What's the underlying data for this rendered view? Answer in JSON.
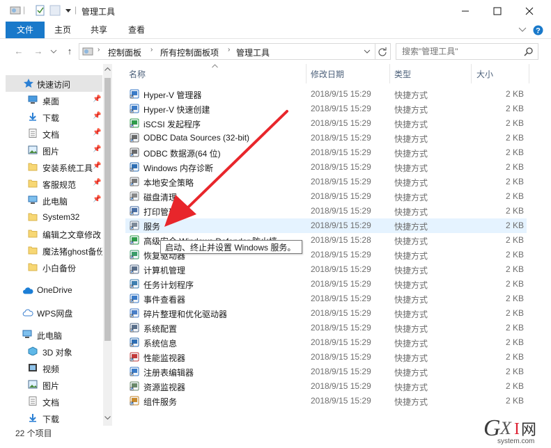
{
  "window": {
    "title": "管理工具",
    "min_label": "─",
    "max_label": "☐",
    "close_label": "✕"
  },
  "ribbon": {
    "tabs": [
      {
        "label": "文件"
      },
      {
        "label": "主页"
      },
      {
        "label": "共享"
      },
      {
        "label": "查看"
      }
    ]
  },
  "address": {
    "crumbs": [
      "控制面板",
      "所有控制面板项",
      "管理工具"
    ]
  },
  "search": {
    "placeholder": "搜索\"管理工具\""
  },
  "sidebar": {
    "quick_access": "快速访问",
    "items": [
      {
        "label": "桌面",
        "icon": "desktop-icon",
        "pinned": true
      },
      {
        "label": "下载",
        "icon": "download-icon",
        "pinned": true
      },
      {
        "label": "文档",
        "icon": "document-icon",
        "pinned": true
      },
      {
        "label": "图片",
        "icon": "picture-icon",
        "pinned": true
      },
      {
        "label": "安装系统工具",
        "icon": "folder-icon",
        "pinned": true
      },
      {
        "label": "客服规范",
        "icon": "folder-icon",
        "pinned": true
      },
      {
        "label": "此电脑",
        "icon": "pc-icon",
        "pinned": true
      },
      {
        "label": "System32",
        "icon": "folder-icon",
        "pinned": false
      },
      {
        "label": "编辑之文章修改",
        "icon": "folder-icon",
        "pinned": false
      },
      {
        "label": "魔法猪ghost备份",
        "icon": "folder-icon",
        "pinned": false
      },
      {
        "label": "小白备份",
        "icon": "folder-icon",
        "pinned": false
      }
    ],
    "onedrive": "OneDrive",
    "wps": "WPS网盘",
    "thispc": "此电脑",
    "pc_items": [
      {
        "label": "3D 对象",
        "icon": "3d-objects-icon"
      },
      {
        "label": "视频",
        "icon": "video-icon"
      },
      {
        "label": "图片",
        "icon": "picture-icon"
      },
      {
        "label": "文档",
        "icon": "document-icon"
      },
      {
        "label": "下载",
        "icon": "download-icon"
      }
    ]
  },
  "columns": {
    "name": "名称",
    "date": "修改日期",
    "type": "类型",
    "size": "大小"
  },
  "files": [
    {
      "name": "Hyper-V 管理器",
      "date": "2018/9/15 15:29",
      "type": "快捷方式",
      "size": "2 KB"
    },
    {
      "name": "Hyper-V 快速创建",
      "date": "2018/9/15 15:29",
      "type": "快捷方式",
      "size": "2 KB"
    },
    {
      "name": "iSCSI 发起程序",
      "date": "2018/9/15 15:29",
      "type": "快捷方式",
      "size": "2 KB"
    },
    {
      "name": "ODBC Data Sources (32-bit)",
      "date": "2018/9/15 15:29",
      "type": "快捷方式",
      "size": "2 KB"
    },
    {
      "name": "ODBC 数据源(64 位)",
      "date": "2018/9/15 15:29",
      "type": "快捷方式",
      "size": "2 KB"
    },
    {
      "name": "Windows 内存诊断",
      "date": "2018/9/15 15:29",
      "type": "快捷方式",
      "size": "2 KB"
    },
    {
      "name": "本地安全策略",
      "date": "2018/9/15 15:29",
      "type": "快捷方式",
      "size": "2 KB"
    },
    {
      "name": "磁盘清理",
      "date": "2018/9/15 15:29",
      "type": "快捷方式",
      "size": "2 KB"
    },
    {
      "name": "打印管理",
      "date": "2018/9/15 15:29",
      "type": "快捷方式",
      "size": "2 KB"
    },
    {
      "name": "服务",
      "date": "2018/9/15 15:29",
      "type": "快捷方式",
      "size": "2 KB"
    },
    {
      "name": "高级安全 Windows Defender 防火墙",
      "date": "2018/9/15 15:28",
      "type": "快捷方式",
      "size": "2 KB"
    },
    {
      "name": "恢复驱动器",
      "date": "2018/9/15 15:29",
      "type": "快捷方式",
      "size": "2 KB"
    },
    {
      "name": "计算机管理",
      "date": "2018/9/15 15:29",
      "type": "快捷方式",
      "size": "2 KB"
    },
    {
      "name": "任务计划程序",
      "date": "2018/9/15 15:29",
      "type": "快捷方式",
      "size": "2 KB"
    },
    {
      "name": "事件查看器",
      "date": "2018/9/15 15:29",
      "type": "快捷方式",
      "size": "2 KB"
    },
    {
      "name": "碎片整理和优化驱动器",
      "date": "2018/9/15 15:29",
      "type": "快捷方式",
      "size": "2 KB"
    },
    {
      "name": "系统配置",
      "date": "2018/9/15 15:29",
      "type": "快捷方式",
      "size": "2 KB"
    },
    {
      "name": "系统信息",
      "date": "2018/9/15 15:29",
      "type": "快捷方式",
      "size": "2 KB"
    },
    {
      "name": "性能监视器",
      "date": "2018/9/15 15:29",
      "type": "快捷方式",
      "size": "2 KB"
    },
    {
      "name": "注册表编辑器",
      "date": "2018/9/15 15:29",
      "type": "快捷方式",
      "size": "2 KB"
    },
    {
      "name": "资源监视器",
      "date": "2018/9/15 15:29",
      "type": "快捷方式",
      "size": "2 KB"
    },
    {
      "name": "组件服务",
      "date": "2018/9/15 15:29",
      "type": "快捷方式",
      "size": "2 KB"
    }
  ],
  "tooltip": "启动、终止并设置 Windows 服务。",
  "status": {
    "count": "22 个项目"
  },
  "watermark": {
    "brand": "GXI网",
    "site": "system.com"
  },
  "colors": {
    "accent": "#1979ca",
    "selection": "#e5f3ff",
    "arrow": "#e8262b"
  }
}
